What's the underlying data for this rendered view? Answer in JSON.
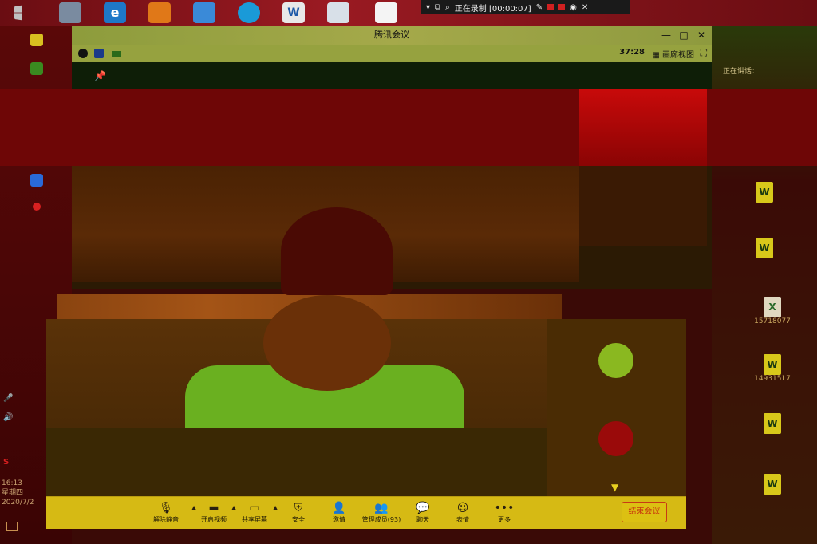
{
  "taskbar": {
    "icons": [
      "recycle-bin-icon",
      "edge-browser-icon",
      "fire-app-icon",
      "tencent-meeting-taskbar-icon",
      "swirl-app-icon",
      "word-taskbar-icon",
      "notes-app-icon",
      "document-app-icon"
    ],
    "win_logo": "windows-start-icon"
  },
  "recording_bar": {
    "status": "正在录制 [00:00:07]"
  },
  "meeting_window": {
    "title": "腾讯会议",
    "timer": "37:28",
    "layout_label": "画廊视图",
    "controls": {
      "minimize": "—",
      "maximize": "□",
      "close": "✕"
    }
  },
  "toolbar": {
    "unmute": "解除静音",
    "start_video": "开启视频",
    "share_screen": "共享屏幕",
    "security": "安全",
    "invite": "邀请",
    "manage_members": "管理成员(93)",
    "chat": "聊天",
    "reactions": "表情",
    "more": "更多",
    "end_meeting": "结束会议"
  },
  "desktop_right": {
    "speaking": "正在讲话：",
    "files": [
      {
        "name": "14931517",
        "type": "word"
      },
      {
        "name": "15718077",
        "type": "excel"
      }
    ]
  },
  "clock": {
    "time": "16:13",
    "weekday": "星期四",
    "date": "2020/7/2"
  },
  "colors": {
    "toolbar_bg": "#d6ba14",
    "title_bar": "#a5a94a",
    "end_button": "#c8380e"
  }
}
